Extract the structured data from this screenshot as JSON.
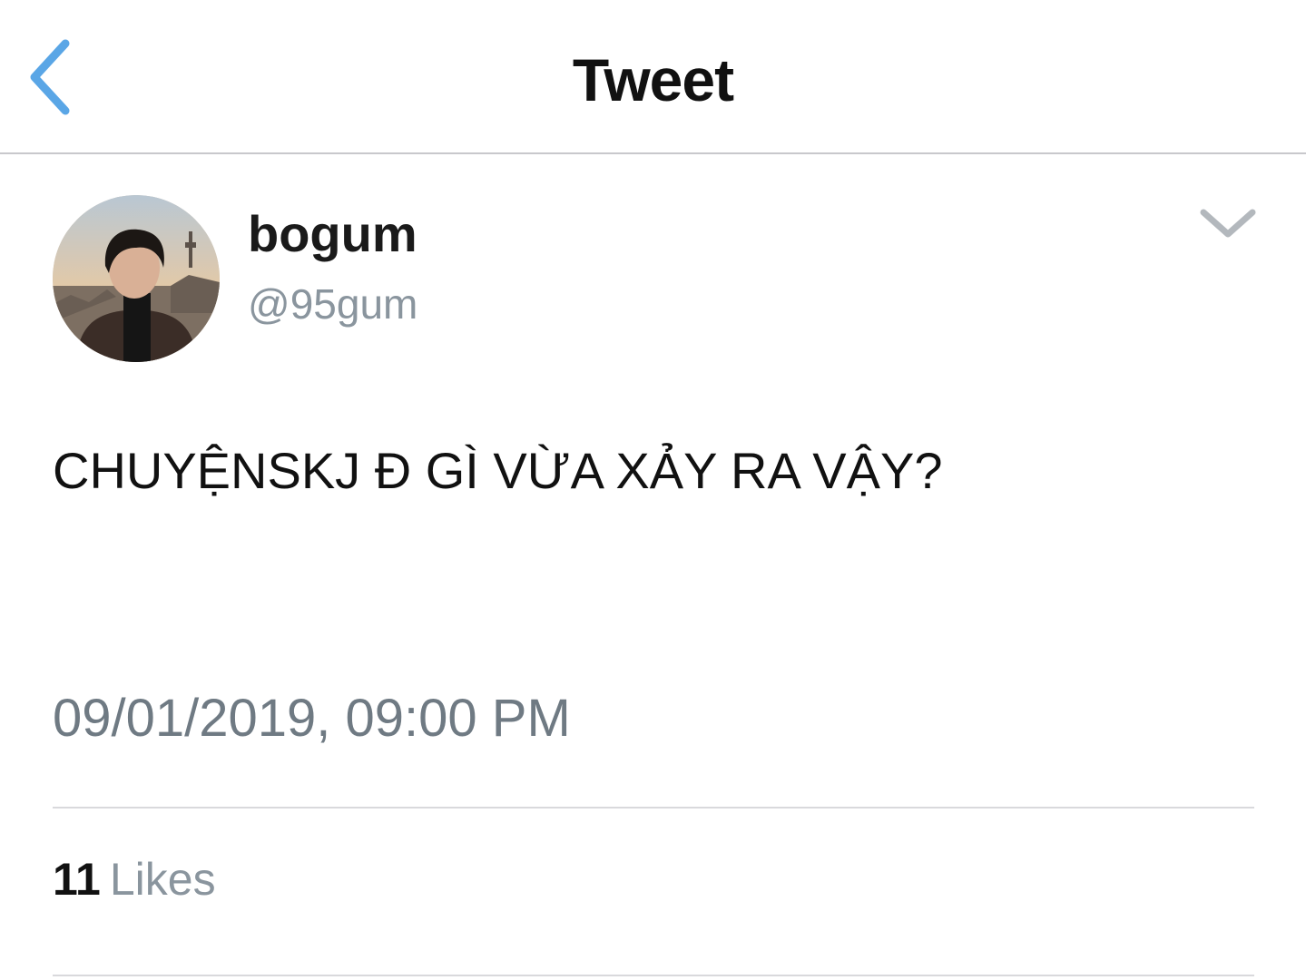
{
  "header": {
    "title": "Tweet",
    "back_icon": "chevron-left-icon",
    "accent_color": "#5aa6e6"
  },
  "tweet": {
    "author": {
      "display_name": "bogum",
      "handle": "@95gum",
      "avatar_icon": "profile-photo"
    },
    "menu_icon": "chevron-down-icon",
    "text": "CHUYỆNSKJ Đ GÌ VỪA XẢY RA VẬY?",
    "timestamp": "09/01/2019, 09:00 PM",
    "likes": {
      "count": "11",
      "label": "Likes"
    }
  }
}
